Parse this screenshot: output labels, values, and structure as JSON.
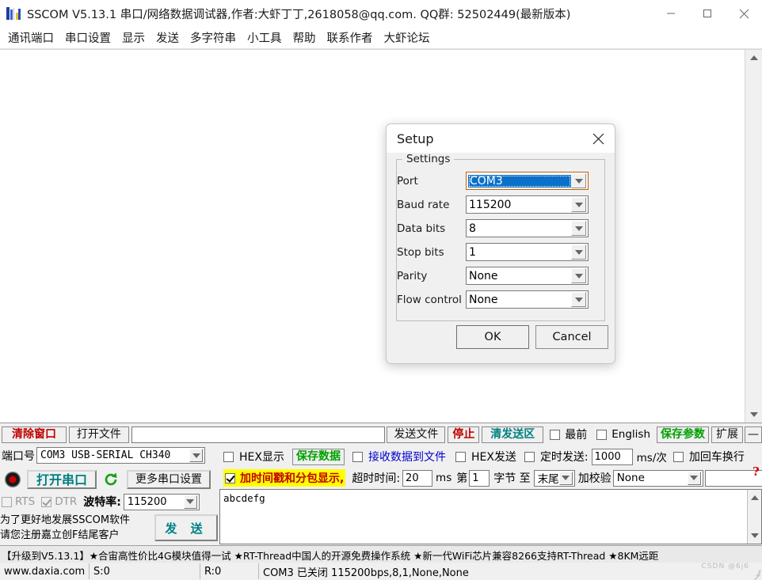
{
  "window": {
    "title": "SSCOM V5.13.1 串口/网络数据调试器,作者:大虾丁丁,2618058@qq.com. QQ群: 52502449(最新版本)",
    "app_icon": "sscom-app-icon",
    "minimize": "−",
    "maximize": "□",
    "close": "✕"
  },
  "menu": {
    "items": [
      {
        "label": "通讯端口"
      },
      {
        "label": "串口设置"
      },
      {
        "label": "显示"
      },
      {
        "label": "发送"
      },
      {
        "label": "多字符串"
      },
      {
        "label": "小工具"
      },
      {
        "label": "帮助"
      },
      {
        "label": "联系作者"
      },
      {
        "label": "大虾论坛"
      }
    ]
  },
  "receive_area": {
    "text": ""
  },
  "toolbar_row1": {
    "clear_window": "清除窗口",
    "open_file": "打开文件",
    "file_path_value": "",
    "send_file": "发送文件",
    "stop": "停止",
    "clear_send": "清发送区",
    "topmost_label": "最前",
    "topmost_checked": false,
    "english_label": "English",
    "english_checked": false,
    "save_params": "保存参数",
    "extend": "扩展",
    "collapse": "—"
  },
  "left_panel": {
    "port_label": "端口号",
    "port_value": "COM3 USB-SERIAL CH340",
    "open_port_button": "打开串口",
    "refresh_icon": "refresh-icon",
    "more_settings": "更多串口设置",
    "rts_label": "RTS",
    "rts_checked": false,
    "dtr_label": "DTR",
    "dtr_checked": true,
    "baud_label": "波特率:",
    "baud_value": "115200",
    "promo_line1": "为了更好地发展SSCOM软件",
    "promo_line2": "请您注册嘉立创F结尾客户",
    "send_button": "发 送"
  },
  "recv_options": {
    "hex_display_label": "HEX显示",
    "hex_display_checked": false,
    "save_data": "保存数据",
    "recv_to_file_label": "接收数据到文件",
    "recv_to_file_checked": false,
    "timestamp_label": "加时间戳和分包显示,",
    "timestamp_checked": true,
    "timeout_label": "超时时间:",
    "timeout_value": "20",
    "timeout_unit": "ms"
  },
  "send_options": {
    "hex_send_label": "HEX发送",
    "hex_send_checked": false,
    "timed_send_label": "定时发送:",
    "timed_send_checked": false,
    "interval_value": "1000",
    "interval_unit": "ms/次",
    "crlf_label": "加回车换行",
    "crlf_checked": false,
    "byte_prefix": "第",
    "byte_start": "1",
    "byte_mid": "字节 至",
    "byte_end_value": "末尾",
    "checksum_label": "加校验",
    "checksum_value": "None",
    "extra_value": "",
    "help_icon": "help-question-icon"
  },
  "send_area": {
    "text": "abcdefg"
  },
  "ad_bar": {
    "text": "【升级到V5.13.1】★合宙高性价比4G模块值得一试 ★RT-Thread中国人的开源免费操作系统 ★新一代WiFi芯片兼容8266支持RT-Thread ★8KM远距"
  },
  "status_bar": {
    "website": "www.daxia.com",
    "sent": "S:0",
    "received": "R:0",
    "port_status": "COM3 已关闭  115200bps,8,1,None,None",
    "watermark": "CSDN @6j6"
  },
  "dialog": {
    "title": "Setup",
    "close_icon": "close-icon",
    "group_label": "Settings",
    "fields": [
      {
        "label": "Port",
        "value": "COM3",
        "focused": true
      },
      {
        "label": "Baud rate",
        "value": "115200",
        "focused": false
      },
      {
        "label": "Data bits",
        "value": "8",
        "focused": false
      },
      {
        "label": "Stop bits",
        "value": "1",
        "focused": false
      },
      {
        "label": "Parity",
        "value": "None",
        "focused": false
      },
      {
        "label": "Flow control",
        "value": "None",
        "focused": false
      }
    ],
    "ok": "OK",
    "cancel": "Cancel"
  },
  "colors": {
    "accent_blue": "#0a70c8",
    "red": "#c00000",
    "green": "#00a000",
    "teal": "#008080",
    "highlight_yellow": "#ffff00"
  }
}
